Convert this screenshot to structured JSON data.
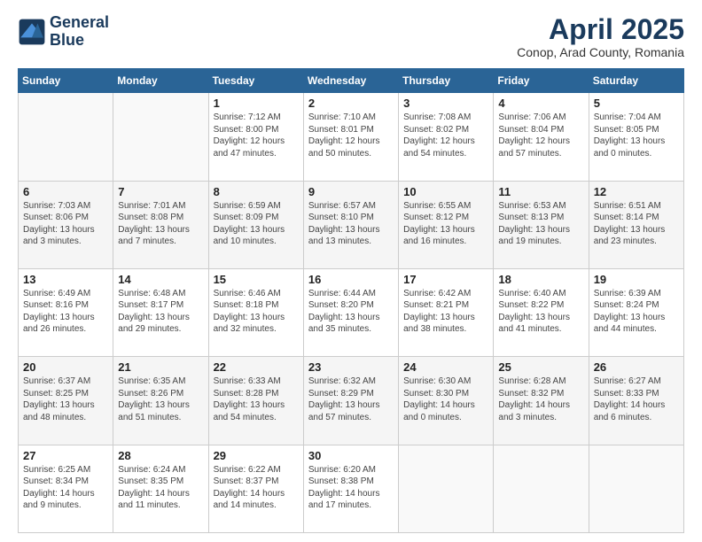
{
  "header": {
    "logo_line1": "General",
    "logo_line2": "Blue",
    "month": "April 2025",
    "location": "Conop, Arad County, Romania"
  },
  "weekdays": [
    "Sunday",
    "Monday",
    "Tuesday",
    "Wednesday",
    "Thursday",
    "Friday",
    "Saturday"
  ],
  "weeks": [
    [
      {
        "day": "",
        "text": ""
      },
      {
        "day": "",
        "text": ""
      },
      {
        "day": "1",
        "text": "Sunrise: 7:12 AM\nSunset: 8:00 PM\nDaylight: 12 hours\nand 47 minutes."
      },
      {
        "day": "2",
        "text": "Sunrise: 7:10 AM\nSunset: 8:01 PM\nDaylight: 12 hours\nand 50 minutes."
      },
      {
        "day": "3",
        "text": "Sunrise: 7:08 AM\nSunset: 8:02 PM\nDaylight: 12 hours\nand 54 minutes."
      },
      {
        "day": "4",
        "text": "Sunrise: 7:06 AM\nSunset: 8:04 PM\nDaylight: 12 hours\nand 57 minutes."
      },
      {
        "day": "5",
        "text": "Sunrise: 7:04 AM\nSunset: 8:05 PM\nDaylight: 13 hours\nand 0 minutes."
      }
    ],
    [
      {
        "day": "6",
        "text": "Sunrise: 7:03 AM\nSunset: 8:06 PM\nDaylight: 13 hours\nand 3 minutes."
      },
      {
        "day": "7",
        "text": "Sunrise: 7:01 AM\nSunset: 8:08 PM\nDaylight: 13 hours\nand 7 minutes."
      },
      {
        "day": "8",
        "text": "Sunrise: 6:59 AM\nSunset: 8:09 PM\nDaylight: 13 hours\nand 10 minutes."
      },
      {
        "day": "9",
        "text": "Sunrise: 6:57 AM\nSunset: 8:10 PM\nDaylight: 13 hours\nand 13 minutes."
      },
      {
        "day": "10",
        "text": "Sunrise: 6:55 AM\nSunset: 8:12 PM\nDaylight: 13 hours\nand 16 minutes."
      },
      {
        "day": "11",
        "text": "Sunrise: 6:53 AM\nSunset: 8:13 PM\nDaylight: 13 hours\nand 19 minutes."
      },
      {
        "day": "12",
        "text": "Sunrise: 6:51 AM\nSunset: 8:14 PM\nDaylight: 13 hours\nand 23 minutes."
      }
    ],
    [
      {
        "day": "13",
        "text": "Sunrise: 6:49 AM\nSunset: 8:16 PM\nDaylight: 13 hours\nand 26 minutes."
      },
      {
        "day": "14",
        "text": "Sunrise: 6:48 AM\nSunset: 8:17 PM\nDaylight: 13 hours\nand 29 minutes."
      },
      {
        "day": "15",
        "text": "Sunrise: 6:46 AM\nSunset: 8:18 PM\nDaylight: 13 hours\nand 32 minutes."
      },
      {
        "day": "16",
        "text": "Sunrise: 6:44 AM\nSunset: 8:20 PM\nDaylight: 13 hours\nand 35 minutes."
      },
      {
        "day": "17",
        "text": "Sunrise: 6:42 AM\nSunset: 8:21 PM\nDaylight: 13 hours\nand 38 minutes."
      },
      {
        "day": "18",
        "text": "Sunrise: 6:40 AM\nSunset: 8:22 PM\nDaylight: 13 hours\nand 41 minutes."
      },
      {
        "day": "19",
        "text": "Sunrise: 6:39 AM\nSunset: 8:24 PM\nDaylight: 13 hours\nand 44 minutes."
      }
    ],
    [
      {
        "day": "20",
        "text": "Sunrise: 6:37 AM\nSunset: 8:25 PM\nDaylight: 13 hours\nand 48 minutes."
      },
      {
        "day": "21",
        "text": "Sunrise: 6:35 AM\nSunset: 8:26 PM\nDaylight: 13 hours\nand 51 minutes."
      },
      {
        "day": "22",
        "text": "Sunrise: 6:33 AM\nSunset: 8:28 PM\nDaylight: 13 hours\nand 54 minutes."
      },
      {
        "day": "23",
        "text": "Sunrise: 6:32 AM\nSunset: 8:29 PM\nDaylight: 13 hours\nand 57 minutes."
      },
      {
        "day": "24",
        "text": "Sunrise: 6:30 AM\nSunset: 8:30 PM\nDaylight: 14 hours\nand 0 minutes."
      },
      {
        "day": "25",
        "text": "Sunrise: 6:28 AM\nSunset: 8:32 PM\nDaylight: 14 hours\nand 3 minutes."
      },
      {
        "day": "26",
        "text": "Sunrise: 6:27 AM\nSunset: 8:33 PM\nDaylight: 14 hours\nand 6 minutes."
      }
    ],
    [
      {
        "day": "27",
        "text": "Sunrise: 6:25 AM\nSunset: 8:34 PM\nDaylight: 14 hours\nand 9 minutes."
      },
      {
        "day": "28",
        "text": "Sunrise: 6:24 AM\nSunset: 8:35 PM\nDaylight: 14 hours\nand 11 minutes."
      },
      {
        "day": "29",
        "text": "Sunrise: 6:22 AM\nSunset: 8:37 PM\nDaylight: 14 hours\nand 14 minutes."
      },
      {
        "day": "30",
        "text": "Sunrise: 6:20 AM\nSunset: 8:38 PM\nDaylight: 14 hours\nand 17 minutes."
      },
      {
        "day": "",
        "text": ""
      },
      {
        "day": "",
        "text": ""
      },
      {
        "day": "",
        "text": ""
      }
    ]
  ]
}
